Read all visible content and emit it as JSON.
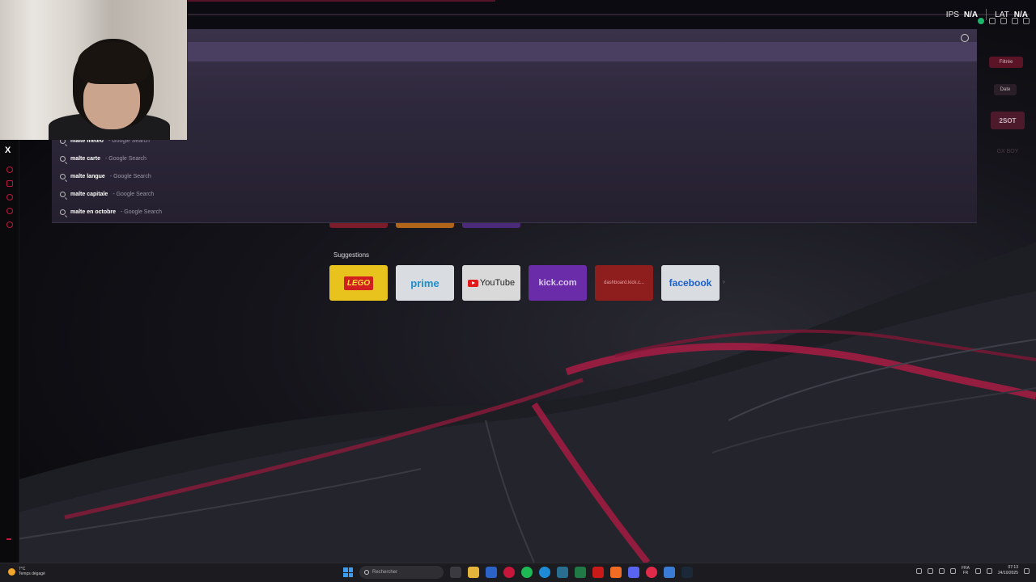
{
  "stats": {
    "ips_label": "IPS",
    "ips_value": "N/A",
    "lat_label": "LAT",
    "lat_value": "N/A"
  },
  "suggestions": [
    {
      "query": "malte meteo",
      "source": "- Google Search"
    },
    {
      "query": "malte carte",
      "source": "- Google Search"
    },
    {
      "query": "malte langue",
      "source": "- Google Search"
    },
    {
      "query": "malte capitale",
      "source": "- Google Search"
    },
    {
      "query": "malte en octobre",
      "source": "- Google Search"
    }
  ],
  "speed_dial": {
    "title": "Suggestions",
    "tiles": [
      {
        "name": "lego",
        "label": "LEGO"
      },
      {
        "name": "prime",
        "label": "prime"
      },
      {
        "name": "youtube",
        "label": "YouTube"
      },
      {
        "name": "kick",
        "label": "kick.com"
      },
      {
        "name": "dashboard",
        "label": "dashboard.kick.c..."
      },
      {
        "name": "facebook",
        "label": "facebook"
      }
    ]
  },
  "right_panel": {
    "button1": "Filtrée",
    "button2": "Date",
    "badge": "2SOT",
    "faded": "GX BOY"
  },
  "taskbar": {
    "weather_temp": "7°C",
    "weather_desc": "Temps dégagé",
    "search_placeholder": "Rechercher",
    "lang_top": "FRA",
    "lang_bottom": "FR",
    "time": "07:13",
    "date": "24/10/2025"
  },
  "colors": {
    "accent": "#c0163d",
    "dropdown": "#2d273b"
  }
}
